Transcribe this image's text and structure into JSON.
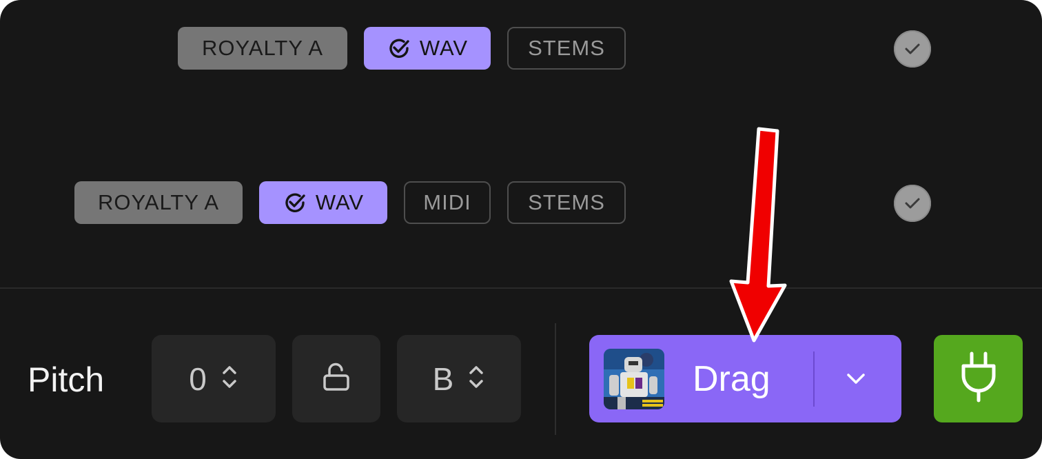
{
  "rows": [
    {
      "tags": [
        {
          "label": "ROYALTY A",
          "style": "gray"
        },
        {
          "label": "WAV",
          "style": "purple",
          "icon": "check-circle-icon"
        },
        {
          "label": "STEMS",
          "style": "outline"
        }
      ],
      "status_icon": "checkmark-circle-icon"
    },
    {
      "tags": [
        {
          "label": "ROYALTY A",
          "style": "gray"
        },
        {
          "label": "WAV",
          "style": "purple",
          "icon": "check-circle-icon"
        },
        {
          "label": "MIDI",
          "style": "outline"
        },
        {
          "label": "STEMS",
          "style": "outline"
        }
      ],
      "status_icon": "checkmark-circle-icon"
    }
  ],
  "toolbar": {
    "pitch_label": "Pitch",
    "pitch_value": "0",
    "lock_icon": "unlock-icon",
    "key_value": "B",
    "drag_label": "Drag",
    "drag_thumbnail": "robot-artwork-thumbnail",
    "dropdown_icon": "chevron-down-icon",
    "plugin_icon": "plug-icon"
  },
  "colors": {
    "background": "#171717",
    "accent_purple": "#8a67f6",
    "tag_purple": "#a592ff",
    "tag_gray": "#767676",
    "plugin_green": "#55a81e",
    "annotation_red": "#f00000"
  },
  "annotation": {
    "type": "arrow",
    "color": "#f00000",
    "direction": "down"
  }
}
